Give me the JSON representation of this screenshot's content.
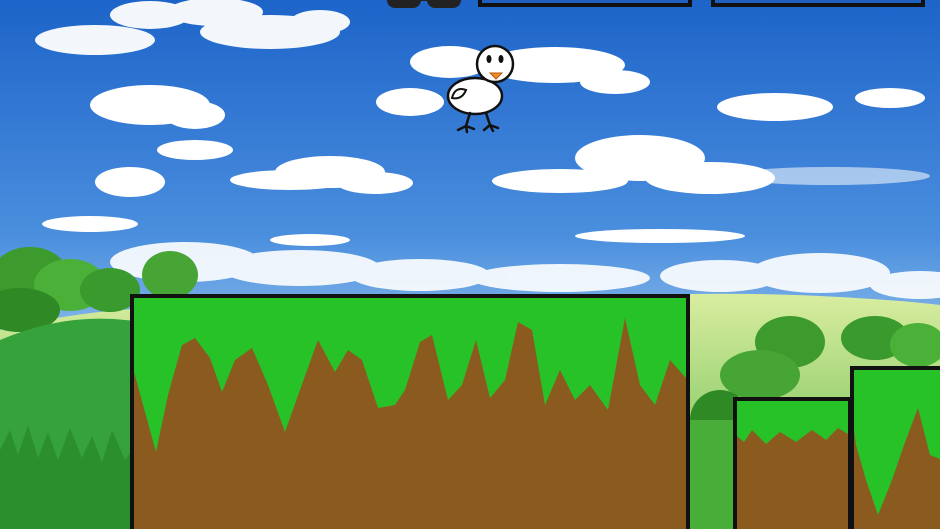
{
  "game": {
    "hud": {
      "icon": "goggles-icon",
      "bar_count": 2
    },
    "player": {
      "character": "white-chick",
      "icon": "chick-icon"
    },
    "platforms": [
      {
        "name": "grass-dirt-platform-large"
      },
      {
        "name": "grass-dirt-platform-small"
      },
      {
        "name": "grass-dirt-platform-right"
      }
    ],
    "colors": {
      "sky_top": "#1f6fd1",
      "sky_bottom": "#cfe6f7",
      "grass": "#27c227",
      "dirt": "#8b5a1f",
      "outline": "#111111",
      "hill": "#3aa84a"
    }
  }
}
